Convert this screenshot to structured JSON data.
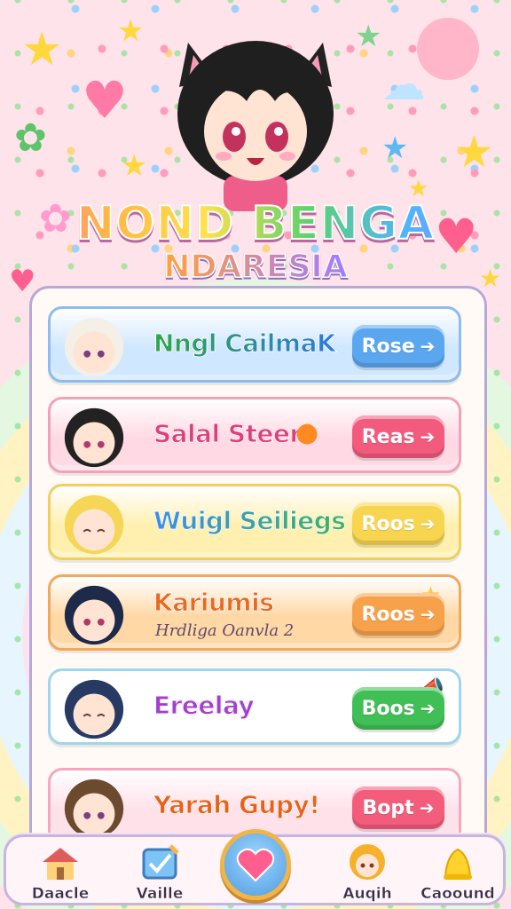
{
  "header": {
    "title_line1": "NOND BENGA",
    "title_line2": "NDARESIA"
  },
  "roster": [
    {
      "name": "Nngl CailmaK",
      "subtitle": "",
      "button": "Rose",
      "theme": "blue",
      "name_color": "#2fa54a",
      "name_color2": "#2c7be0",
      "bg": "#cfe7ff",
      "border": "#8cbcf0",
      "btn_color": "#5aa6ef",
      "hair": "#f4efe7"
    },
    {
      "name": "Salal Steer",
      "subtitle": "",
      "button": "Reas",
      "theme": "pink",
      "name_color": "#e0407a",
      "name_color2": "#e0407a",
      "bg": "#ffd9e4",
      "border": "#f2a1b9",
      "btn_color": "#f25b7d",
      "hair": "#222222",
      "extra_icon": "orange-icon"
    },
    {
      "name": "Wuigl Seiliegs",
      "subtitle": "",
      "button": "Roos",
      "theme": "yellow",
      "name_color": "#3d8ee5",
      "name_color2": "#43b357",
      "bg": "#fff0b0",
      "border": "#f0cf5b",
      "btn_color": "#f7d54f",
      "hair": "#f6d657"
    },
    {
      "name": "Kariumis",
      "subtitle": "Hrdliga Oanvla 2",
      "button": "Roos",
      "theme": "orange",
      "name_color": "#e86a1c",
      "name_color2": "#e86a1c",
      "bg": "#ffd8a6",
      "border": "#f2a85a",
      "btn_color": "#f7a24a",
      "hair": "#1e2a4a",
      "extra_icon": "star-icon"
    },
    {
      "name": "Ereelay",
      "subtitle": "",
      "button": "Boos",
      "theme": "white",
      "name_color": "#a23fd0",
      "name_color2": "#a23fd0",
      "bg": "#ffffff",
      "border": "#9ed5ef",
      "btn_color": "#3fbf55",
      "hair": "#263a63",
      "extra_icon": "megaphone-icon"
    },
    {
      "name": "Yarah Gupy!",
      "subtitle": "",
      "button": "Bopt",
      "theme": "pink",
      "name_color": "#e8611c",
      "name_color2": "#e8611c",
      "bg": "#ffe1ea",
      "border": "#f4a8c0",
      "btn_color": "#f35c7b",
      "hair": "#6b4a2e"
    }
  ],
  "nav": [
    {
      "label": "Daacle",
      "icon": "house-icon"
    },
    {
      "label": "Vaille",
      "icon": "checklist-icon"
    },
    {
      "label": "",
      "icon": "heart-icon"
    },
    {
      "label": "Auqih",
      "icon": "character-icon"
    },
    {
      "label": "Caoound",
      "icon": "bell-icon"
    }
  ]
}
